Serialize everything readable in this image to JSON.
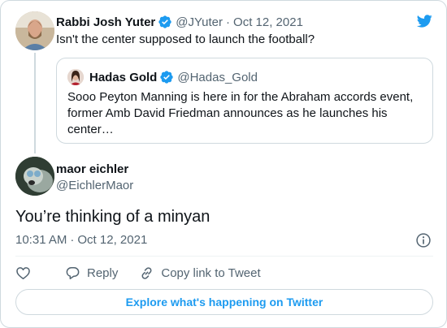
{
  "parent_tweet": {
    "name": "Rabbi Josh Yuter",
    "handle": "@JYuter",
    "separator": "·",
    "date": "Oct 12, 2021",
    "text": "Isn't the center supposed to launch the football?"
  },
  "quoted_tweet": {
    "name": "Hadas Gold",
    "handle": "@Hadas_Gold",
    "text": "Sooo Peyton Manning is here in for the Abraham accords event, former Amb David Friedman announces as he launches his center…"
  },
  "main_tweet": {
    "name": "maor eichler",
    "handle": "@EichlerMaor",
    "text": "You’re thinking of a minyan",
    "time": "10:31 AM",
    "separator": "·",
    "date": "Oct 12, 2021"
  },
  "actions": {
    "reply_label": "Reply",
    "copy_label": "Copy link to Tweet"
  },
  "explore_label": "Explore what's happening on Twitter",
  "colors": {
    "twitter_blue": "#1d9bf0",
    "secondary_text": "#536471",
    "border": "#cfd9de"
  },
  "icons": [
    "twitter-bird-icon",
    "verified-badge-icon",
    "info-icon",
    "heart-icon",
    "reply-icon",
    "link-icon"
  ]
}
